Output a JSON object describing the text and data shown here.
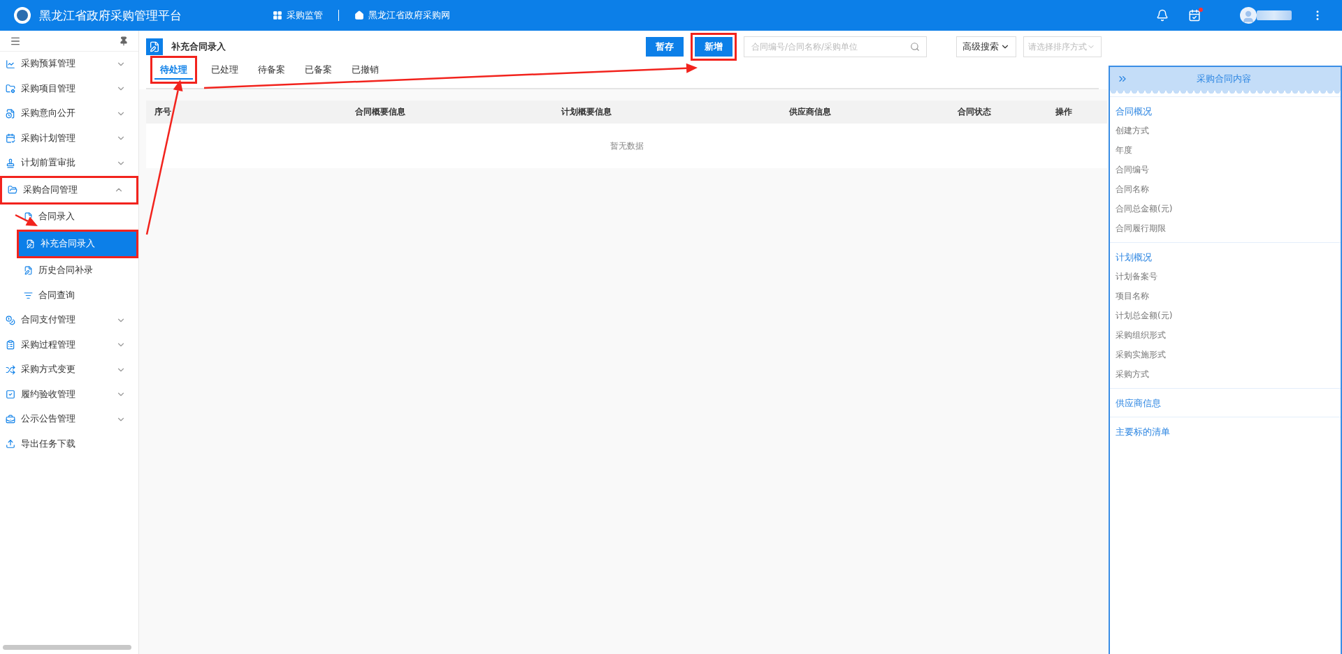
{
  "topbar": {
    "title": "黑龙江省政府采购管理平台",
    "links": [
      {
        "label": "采购监管"
      },
      {
        "label": "黑龙江省政府采购网"
      }
    ],
    "tasks_unread": true
  },
  "sidebar": {
    "items": [
      {
        "kind": "group",
        "label": "采购预算管理",
        "expanded": false,
        "highlighted": false
      },
      {
        "kind": "group",
        "label": "采购项目管理",
        "expanded": false,
        "highlighted": false
      },
      {
        "kind": "group",
        "label": "采购意向公开",
        "expanded": false,
        "highlighted": false
      },
      {
        "kind": "group",
        "label": "采购计划管理",
        "expanded": false,
        "highlighted": false
      },
      {
        "kind": "group",
        "label": "计划前置审批",
        "expanded": false,
        "highlighted": false
      },
      {
        "kind": "group",
        "label": "采购合同管理",
        "expanded": true,
        "highlighted": true,
        "children": [
          {
            "label": "合同录入",
            "selected": false,
            "highlighted": false
          },
          {
            "label": "补充合同录入",
            "selected": true,
            "highlighted": true
          },
          {
            "label": "历史合同补录",
            "selected": false,
            "highlighted": false
          },
          {
            "label": "合同查询",
            "selected": false,
            "highlighted": false
          }
        ]
      },
      {
        "kind": "group",
        "label": "合同支付管理",
        "expanded": false,
        "highlighted": false
      },
      {
        "kind": "group",
        "label": "采购过程管理",
        "expanded": false,
        "highlighted": false
      },
      {
        "kind": "group",
        "label": "采购方式变更",
        "expanded": false,
        "highlighted": false
      },
      {
        "kind": "group",
        "label": "履约验收管理",
        "expanded": false,
        "highlighted": false
      },
      {
        "kind": "group",
        "label": "公示公告管理",
        "expanded": false,
        "highlighted": false
      },
      {
        "kind": "link",
        "label": "导出任务下载",
        "highlighted": false
      }
    ]
  },
  "page": {
    "title": "补充合同录入",
    "tabs": [
      {
        "label": "待处理",
        "selected": true,
        "highlighted": true
      },
      {
        "label": "已处理",
        "selected": false,
        "highlighted": false
      },
      {
        "label": "待备案",
        "selected": false,
        "highlighted": false
      },
      {
        "label": "已备案",
        "selected": false,
        "highlighted": false
      },
      {
        "label": "已撤销",
        "selected": false,
        "highlighted": false
      }
    ],
    "buttons": [
      {
        "label": "暂存",
        "highlighted": false
      },
      {
        "label": "新增",
        "highlighted": true
      }
    ],
    "search": {
      "placeholder": "合同编号/合同名称/采购单位"
    },
    "advanced_search": "高级搜索",
    "sort": {
      "placeholder": "请选择排序方式"
    }
  },
  "table": {
    "columns": [
      "序号",
      "合同概要信息",
      "计划概要信息",
      "供应商信息",
      "合同状态",
      "操作"
    ],
    "empty_text": "暂无数据"
  },
  "right_panel": {
    "title": "采购合同内容",
    "sections": [
      {
        "heading": "合同概况",
        "fields": [
          "创建方式",
          "年度",
          "合同编号",
          "合同名称",
          "合同总金额(元)",
          "合同履行期限"
        ]
      },
      {
        "heading": "计划概况",
        "fields": [
          "计划备案号",
          "项目名称",
          "计划总金额(元)",
          "采购组织形式",
          "采购实施形式",
          "采购方式"
        ]
      },
      {
        "heading": "供应商信息"
      },
      {
        "heading": "主要标的清单"
      }
    ]
  }
}
